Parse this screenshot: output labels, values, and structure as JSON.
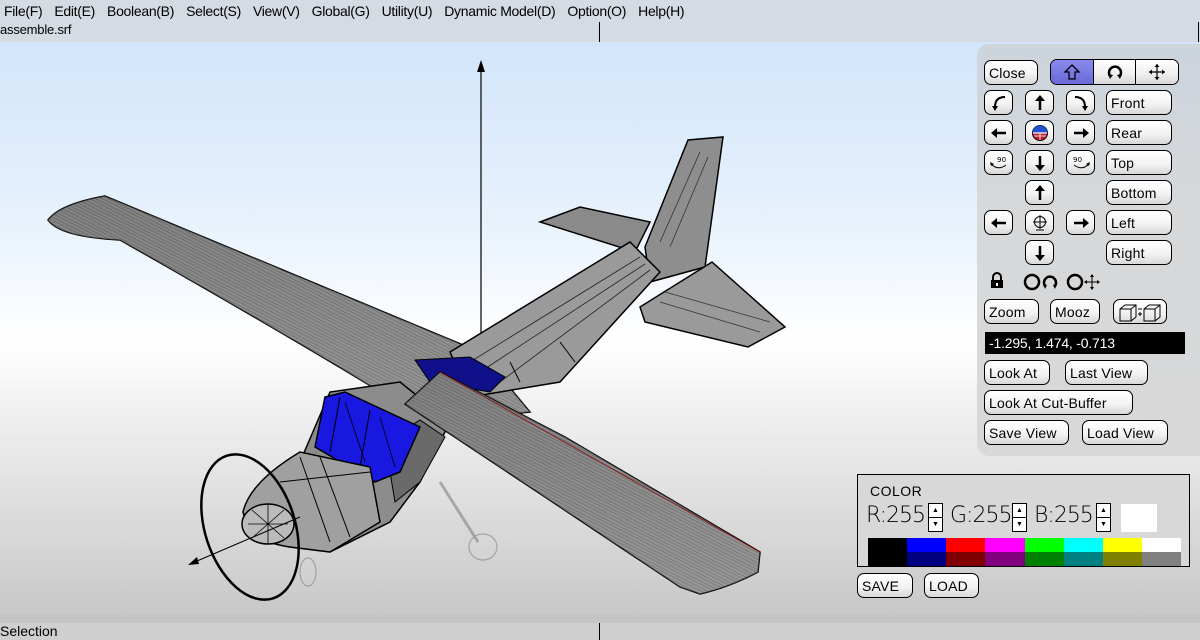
{
  "menu": {
    "items": [
      "File(F)",
      "Edit(E)",
      "Boolean(B)",
      "Select(S)",
      "View(V)",
      "Global(G)",
      "Utility(U)",
      "Dynamic Model(D)",
      "Option(O)",
      "Help(H)"
    ]
  },
  "title": {
    "file_name": "assemble.srf"
  },
  "view_panel": {
    "close_label": "Close",
    "modes": [
      {
        "icon": "translate-up-icon",
        "active": true
      },
      {
        "icon": "rotate-icon",
        "active": false
      },
      {
        "icon": "move-icon",
        "active": false
      }
    ],
    "views": [
      "Front",
      "Rear",
      "Top",
      "Bottom",
      "Left",
      "Right"
    ],
    "rotate_90_ccw": "90",
    "rotate_90_cw": "90",
    "zoom_label": "Zoom",
    "mooz_label": "Mooz",
    "coordinates": "-1.295, 1.474, -0.713",
    "look_at_label": "Look At",
    "last_view_label": "Last View",
    "look_at_cut_buffer_label": "Look At Cut-Buffer",
    "save_view_label": "Save View",
    "load_view_label": "Load View"
  },
  "color_panel": {
    "title": "COLOR",
    "r_label": "R:255",
    "g_label": "G:255",
    "b_label": "B:255",
    "r": 255,
    "g": 255,
    "b": 255,
    "preview_color": "#ffffff",
    "palette": [
      {
        "light": "#000000",
        "dark": "#000000"
      },
      {
        "light": "#0000ff",
        "dark": "#000080"
      },
      {
        "light": "#ff0000",
        "dark": "#800000"
      },
      {
        "light": "#ff00ff",
        "dark": "#800080"
      },
      {
        "light": "#00ff00",
        "dark": "#008000"
      },
      {
        "light": "#00ffff",
        "dark": "#008080"
      },
      {
        "light": "#ffff00",
        "dark": "#808000"
      },
      {
        "light": "#ffffff",
        "dark": "#808080"
      }
    ],
    "save_label": "SAVE",
    "load_label": "LOAD"
  },
  "status": {
    "text": "Selection"
  },
  "colors": {
    "active_mode": "#7070e0",
    "canopy": "#1010d0",
    "fuselage": "#888888"
  }
}
